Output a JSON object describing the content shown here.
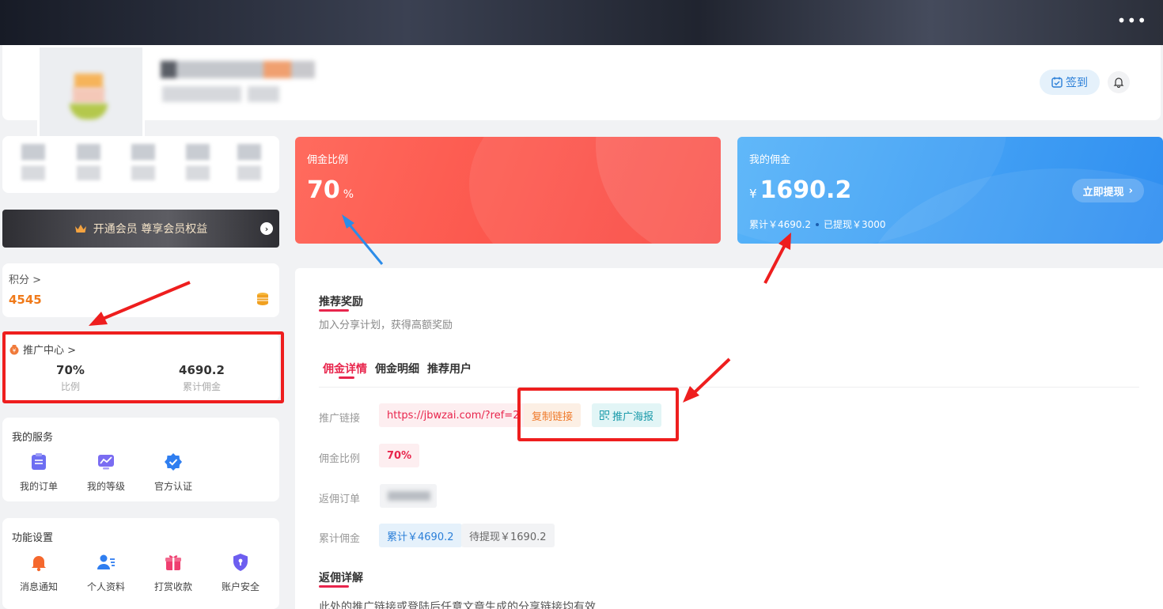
{
  "header": {
    "more": "•••",
    "signin_label": "签到"
  },
  "vip": {
    "label": "开通会员 尊享会员权益"
  },
  "points": {
    "label": "积分 >",
    "value": "4545"
  },
  "promotion": {
    "title": "推广中心 >",
    "ratio_value": "70%",
    "ratio_label": "比例",
    "commission_value": "4690.2",
    "commission_label": "累计佣金"
  },
  "services": {
    "title": "我的服务",
    "items": [
      {
        "label": "我的订单",
        "icon": "order-icon"
      },
      {
        "label": "我的等级",
        "icon": "level-icon"
      },
      {
        "label": "官方认证",
        "icon": "verified-icon"
      }
    ]
  },
  "settings": {
    "title": "功能设置",
    "items": [
      {
        "label": "消息通知",
        "icon": "bell-icon"
      },
      {
        "label": "个人资料",
        "icon": "profile-icon"
      },
      {
        "label": "打赏收款",
        "icon": "gift-icon"
      },
      {
        "label": "账户安全",
        "icon": "shield-icon"
      }
    ]
  },
  "rate_card": {
    "label": "佣金比例",
    "value": "70",
    "unit": "%"
  },
  "commission_card": {
    "label": "我的佣金",
    "currency": "¥",
    "value": "1690.2",
    "cumulative": "累计￥4690.2",
    "withdrawn": "已提现￥3000",
    "withdraw_label": "立即提现"
  },
  "main": {
    "title": "推荐奖励",
    "desc": "加入分享计划，获得高额奖励",
    "tabs": [
      "佣金详情",
      "佣金明细",
      "推荐用户"
    ],
    "link_label": "推广链接",
    "link_value": "https://jbwzai.com/?ref=2",
    "copy_label": "复制链接",
    "poster_label": "推广海报",
    "rate_label": "佣金比例",
    "rate_value": "70%",
    "order_label": "返佣订单",
    "total_label": "累计佣金",
    "total_value": "累计￥4690.2",
    "pending_value": "待提现￥1690.2",
    "detail_title": "返佣详解",
    "detail_text": "此处的推广链接或登陆后任意文章生成的分享链接均有效"
  },
  "colors": {
    "accent": "#e8254c",
    "orange": "#f07a1a",
    "blue": "#2b7fd8",
    "annotation": "#ee1e1e"
  }
}
